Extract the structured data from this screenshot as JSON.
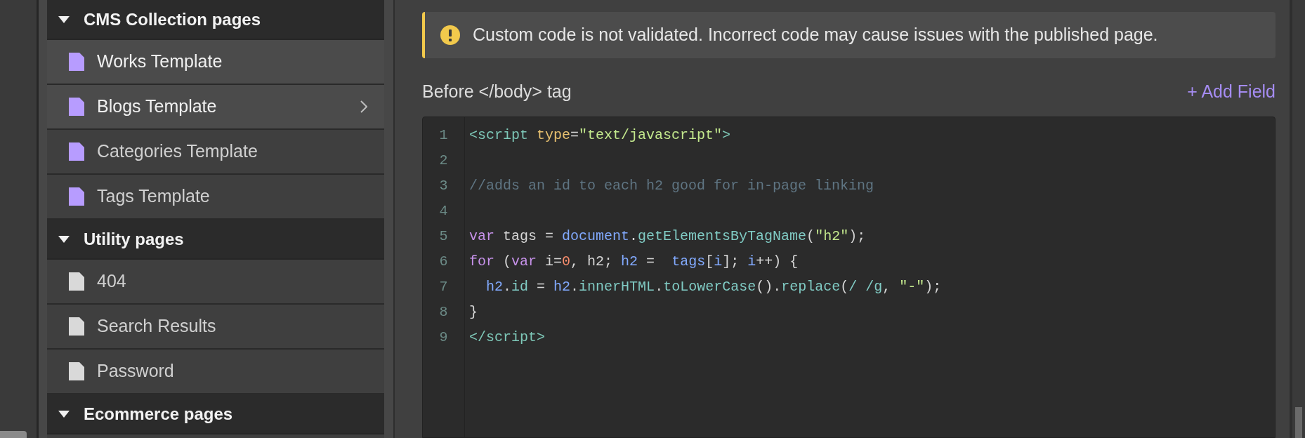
{
  "sidebar": {
    "sections": [
      {
        "title": "CMS Collection pages",
        "expanded": true,
        "items": [
          {
            "name": "Works Template",
            "color": "#b79cff",
            "highlighted": true,
            "has_submenu": false
          },
          {
            "name": "Blogs Template",
            "color": "#b79cff",
            "highlighted": true,
            "has_submenu": true
          },
          {
            "name": "Categories Template",
            "color": "#b79cff",
            "highlighted": false,
            "has_submenu": false
          },
          {
            "name": "Tags Template",
            "color": "#b79cff",
            "highlighted": false,
            "has_submenu": false
          }
        ]
      },
      {
        "title": "Utility pages",
        "expanded": true,
        "items": [
          {
            "name": "404",
            "color": "#d9d9d9",
            "highlighted": false,
            "has_submenu": false
          },
          {
            "name": "Search Results",
            "color": "#d9d9d9",
            "highlighted": false,
            "has_submenu": false
          },
          {
            "name": "Password",
            "color": "#d9d9d9",
            "highlighted": false,
            "has_submenu": false
          }
        ]
      },
      {
        "title": "Ecommerce pages",
        "expanded": true
      }
    ]
  },
  "warning": {
    "text": "Custom code is not validated. Incorrect code may cause issues with the published page."
  },
  "field": {
    "label": "Before </body> tag",
    "add_button": "+ Add Field"
  },
  "code_editor": {
    "lines": [
      {
        "number": "1",
        "tokens": [
          {
            "kind": "tag",
            "text": "<script"
          },
          {
            "kind": "attr",
            "text": " type"
          },
          {
            "kind": "plain",
            "text": "="
          },
          {
            "kind": "string",
            "text": "\"text/javascript\""
          },
          {
            "kind": "tag",
            "text": ">"
          }
        ]
      },
      {
        "number": "2"
      },
      {
        "number": "3",
        "tokens": [
          {
            "kind": "comment",
            "text": "//adds an id to each h2 good for in-page linking"
          }
        ]
      },
      {
        "number": "4"
      },
      {
        "number": "5",
        "tokens": [
          {
            "kind": "keyword",
            "text": "var"
          },
          {
            "kind": "plain",
            "text": " tags = "
          },
          {
            "kind": "variable",
            "text": "document"
          },
          {
            "kind": "plain",
            "text": "."
          },
          {
            "kind": "property",
            "text": "getElementsByTagName"
          },
          {
            "kind": "plain",
            "text": "("
          },
          {
            "kind": "string",
            "text": "\"h2\""
          },
          {
            "kind": "plain",
            "text": ");"
          }
        ]
      },
      {
        "number": "6",
        "tokens": [
          {
            "kind": "keyword",
            "text": "for"
          },
          {
            "kind": "plain",
            "text": " ("
          },
          {
            "kind": "keyword",
            "text": "var"
          },
          {
            "kind": "plain",
            "text": " i="
          },
          {
            "kind": "number",
            "text": "0"
          },
          {
            "kind": "plain",
            "text": ", h2; "
          },
          {
            "kind": "variable",
            "text": "h2"
          },
          {
            "kind": "plain",
            "text": " =  "
          },
          {
            "kind": "variable",
            "text": "tags"
          },
          {
            "kind": "plain",
            "text": "["
          },
          {
            "kind": "variable",
            "text": "i"
          },
          {
            "kind": "plain",
            "text": "]; "
          },
          {
            "kind": "variable",
            "text": "i"
          },
          {
            "kind": "plain",
            "text": "++) {"
          }
        ]
      },
      {
        "number": "7",
        "tokens": [
          {
            "kind": "variable",
            "text": "  h2"
          },
          {
            "kind": "plain",
            "text": "."
          },
          {
            "kind": "property",
            "text": "id"
          },
          {
            "kind": "plain",
            "text": " = "
          },
          {
            "kind": "variable",
            "text": "h2"
          },
          {
            "kind": "plain",
            "text": "."
          },
          {
            "kind": "property",
            "text": "innerHTML"
          },
          {
            "kind": "plain",
            "text": "."
          },
          {
            "kind": "property",
            "text": "toLowerCase"
          },
          {
            "kind": "plain",
            "text": "()."
          },
          {
            "kind": "property",
            "text": "replace"
          },
          {
            "kind": "plain",
            "text": "("
          },
          {
            "kind": "regex",
            "text": "/ /g"
          },
          {
            "kind": "plain",
            "text": ", "
          },
          {
            "kind": "string",
            "text": "\"-\""
          },
          {
            "kind": "plain",
            "text": ");"
          }
        ]
      },
      {
        "number": "8",
        "tokens": [
          {
            "kind": "plain",
            "text": "}"
          }
        ]
      },
      {
        "number": "9",
        "tokens": [
          {
            "kind": "tag",
            "text": "</script>"
          }
        ]
      }
    ]
  }
}
